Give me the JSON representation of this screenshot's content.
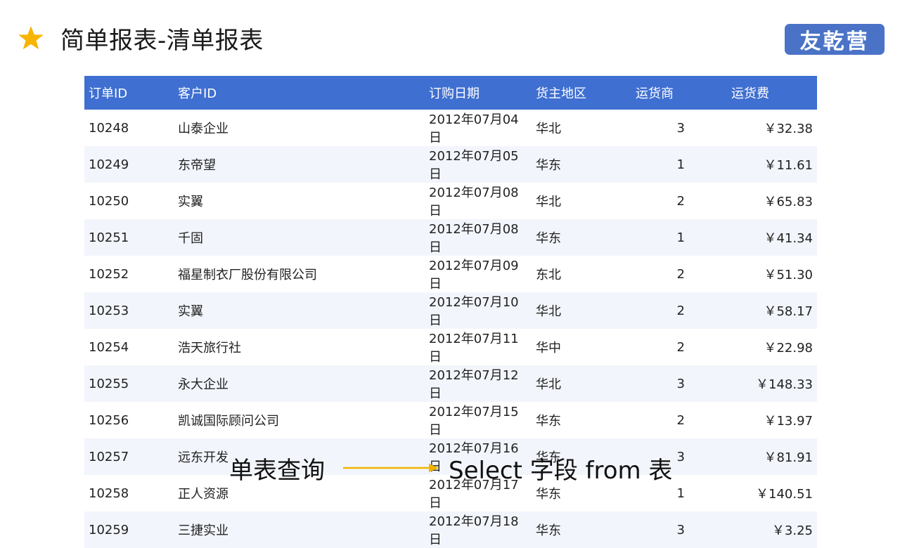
{
  "header": {
    "title": "简单报表-清单报表",
    "logo_text": "友乾营",
    "star_icon": "star-icon",
    "colors": {
      "star": "#f7b500",
      "logo_bg": "#4a73c7",
      "table_header": "#3f6fd1",
      "arrow": "#f0b400"
    }
  },
  "table": {
    "columns": [
      "订单ID",
      "客户ID",
      "订购日期",
      "货主地区",
      "运货商",
      "运货费"
    ],
    "rows": [
      [
        "10248",
        "山泰企业",
        "2012年07月04日",
        "华北",
        "3",
        "￥32.38"
      ],
      [
        "10249",
        "东帝望",
        "2012年07月05日",
        "华东",
        "1",
        "￥11.61"
      ],
      [
        "10250",
        "实翼",
        "2012年07月08日",
        "华北",
        "2",
        "￥65.83"
      ],
      [
        "10251",
        "千固",
        "2012年07月08日",
        "华东",
        "1",
        "￥41.34"
      ],
      [
        "10252",
        "福星制衣厂股份有限公司",
        "2012年07月09日",
        "东北",
        "2",
        "￥51.30"
      ],
      [
        "10253",
        "实翼",
        "2012年07月10日",
        "华北",
        "2",
        "￥58.17"
      ],
      [
        "10254",
        "浩天旅行社",
        "2012年07月11日",
        "华中",
        "2",
        "￥22.98"
      ],
      [
        "10255",
        "永大企业",
        "2012年07月12日",
        "华北",
        "3",
        "￥148.33"
      ],
      [
        "10256",
        "凯诚国际顾问公司",
        "2012年07月15日",
        "华东",
        "2",
        "￥13.97"
      ],
      [
        "10257",
        "远东开发",
        "2012年07月16日",
        "华东",
        "3",
        "￥81.91"
      ],
      [
        "10258",
        "正人资源",
        "2012年07月17日",
        "华东",
        "1",
        "￥140.51"
      ],
      [
        "10259",
        "三捷实业",
        "2012年07月18日",
        "华东",
        "3",
        "￥3.25"
      ]
    ]
  },
  "footer": {
    "left": "单表查询",
    "right": "Select 字段 from 表",
    "arrow_icon": "right-arrow-icon"
  }
}
